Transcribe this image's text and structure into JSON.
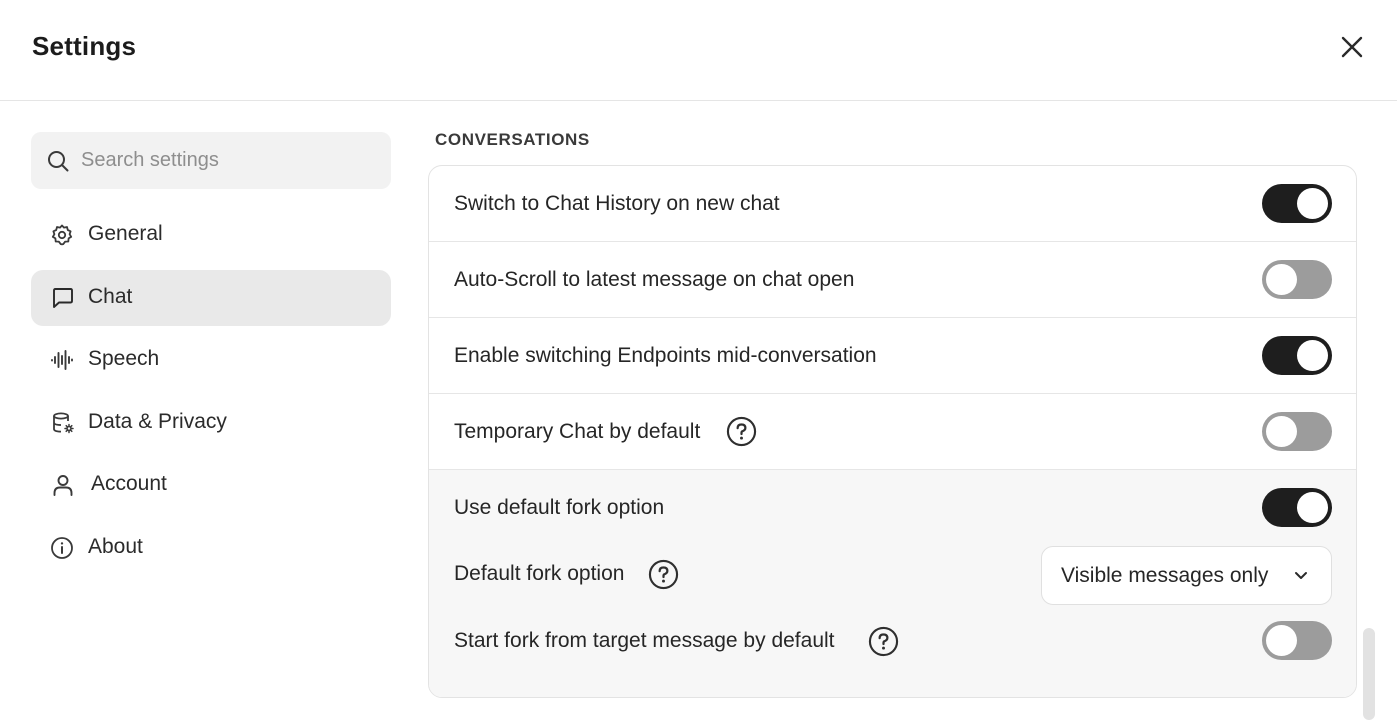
{
  "dialog": {
    "title": "Settings",
    "close_icon": "close-icon"
  },
  "sidebar": {
    "search": {
      "placeholder": "Search settings",
      "value": "",
      "icon": "search-icon"
    },
    "items": [
      {
        "label": "General",
        "icon": "gear-icon",
        "active": false
      },
      {
        "label": "Chat",
        "icon": "message-square-icon",
        "active": true
      },
      {
        "label": "Speech",
        "icon": "audio-waveform-icon",
        "active": false
      },
      {
        "label": "Data & Privacy",
        "icon": "database-gear-icon",
        "active": false
      },
      {
        "label": "Account",
        "icon": "user-icon",
        "active": false
      },
      {
        "label": "About",
        "icon": "info-icon",
        "active": false
      }
    ]
  },
  "main": {
    "section_title": "CONVERSATIONS",
    "rows": [
      {
        "label": "Switch to Chat History on new chat",
        "toggle": true
      },
      {
        "label": "Auto-Scroll to latest message on chat open",
        "toggle": false
      },
      {
        "label": "Enable switching Endpoints mid-conversation",
        "toggle": true
      },
      {
        "label": "Temporary Chat by default",
        "toggle": false,
        "help": true
      }
    ],
    "fork": {
      "use_default_label": "Use default fork option",
      "use_default_toggle": true,
      "default_option_label": "Default fork option",
      "default_option_value": "Visible messages only",
      "start_from_target_label": "Start fork from target message by default",
      "start_from_target_toggle": false
    }
  },
  "colors": {
    "toggle_on": "#1e1e1e",
    "toggle_off": "#9c9c9c",
    "active_nav_bg": "#e9e9e9",
    "search_bg": "#f2f2f2",
    "fork_area_bg": "#f7f7f7"
  }
}
